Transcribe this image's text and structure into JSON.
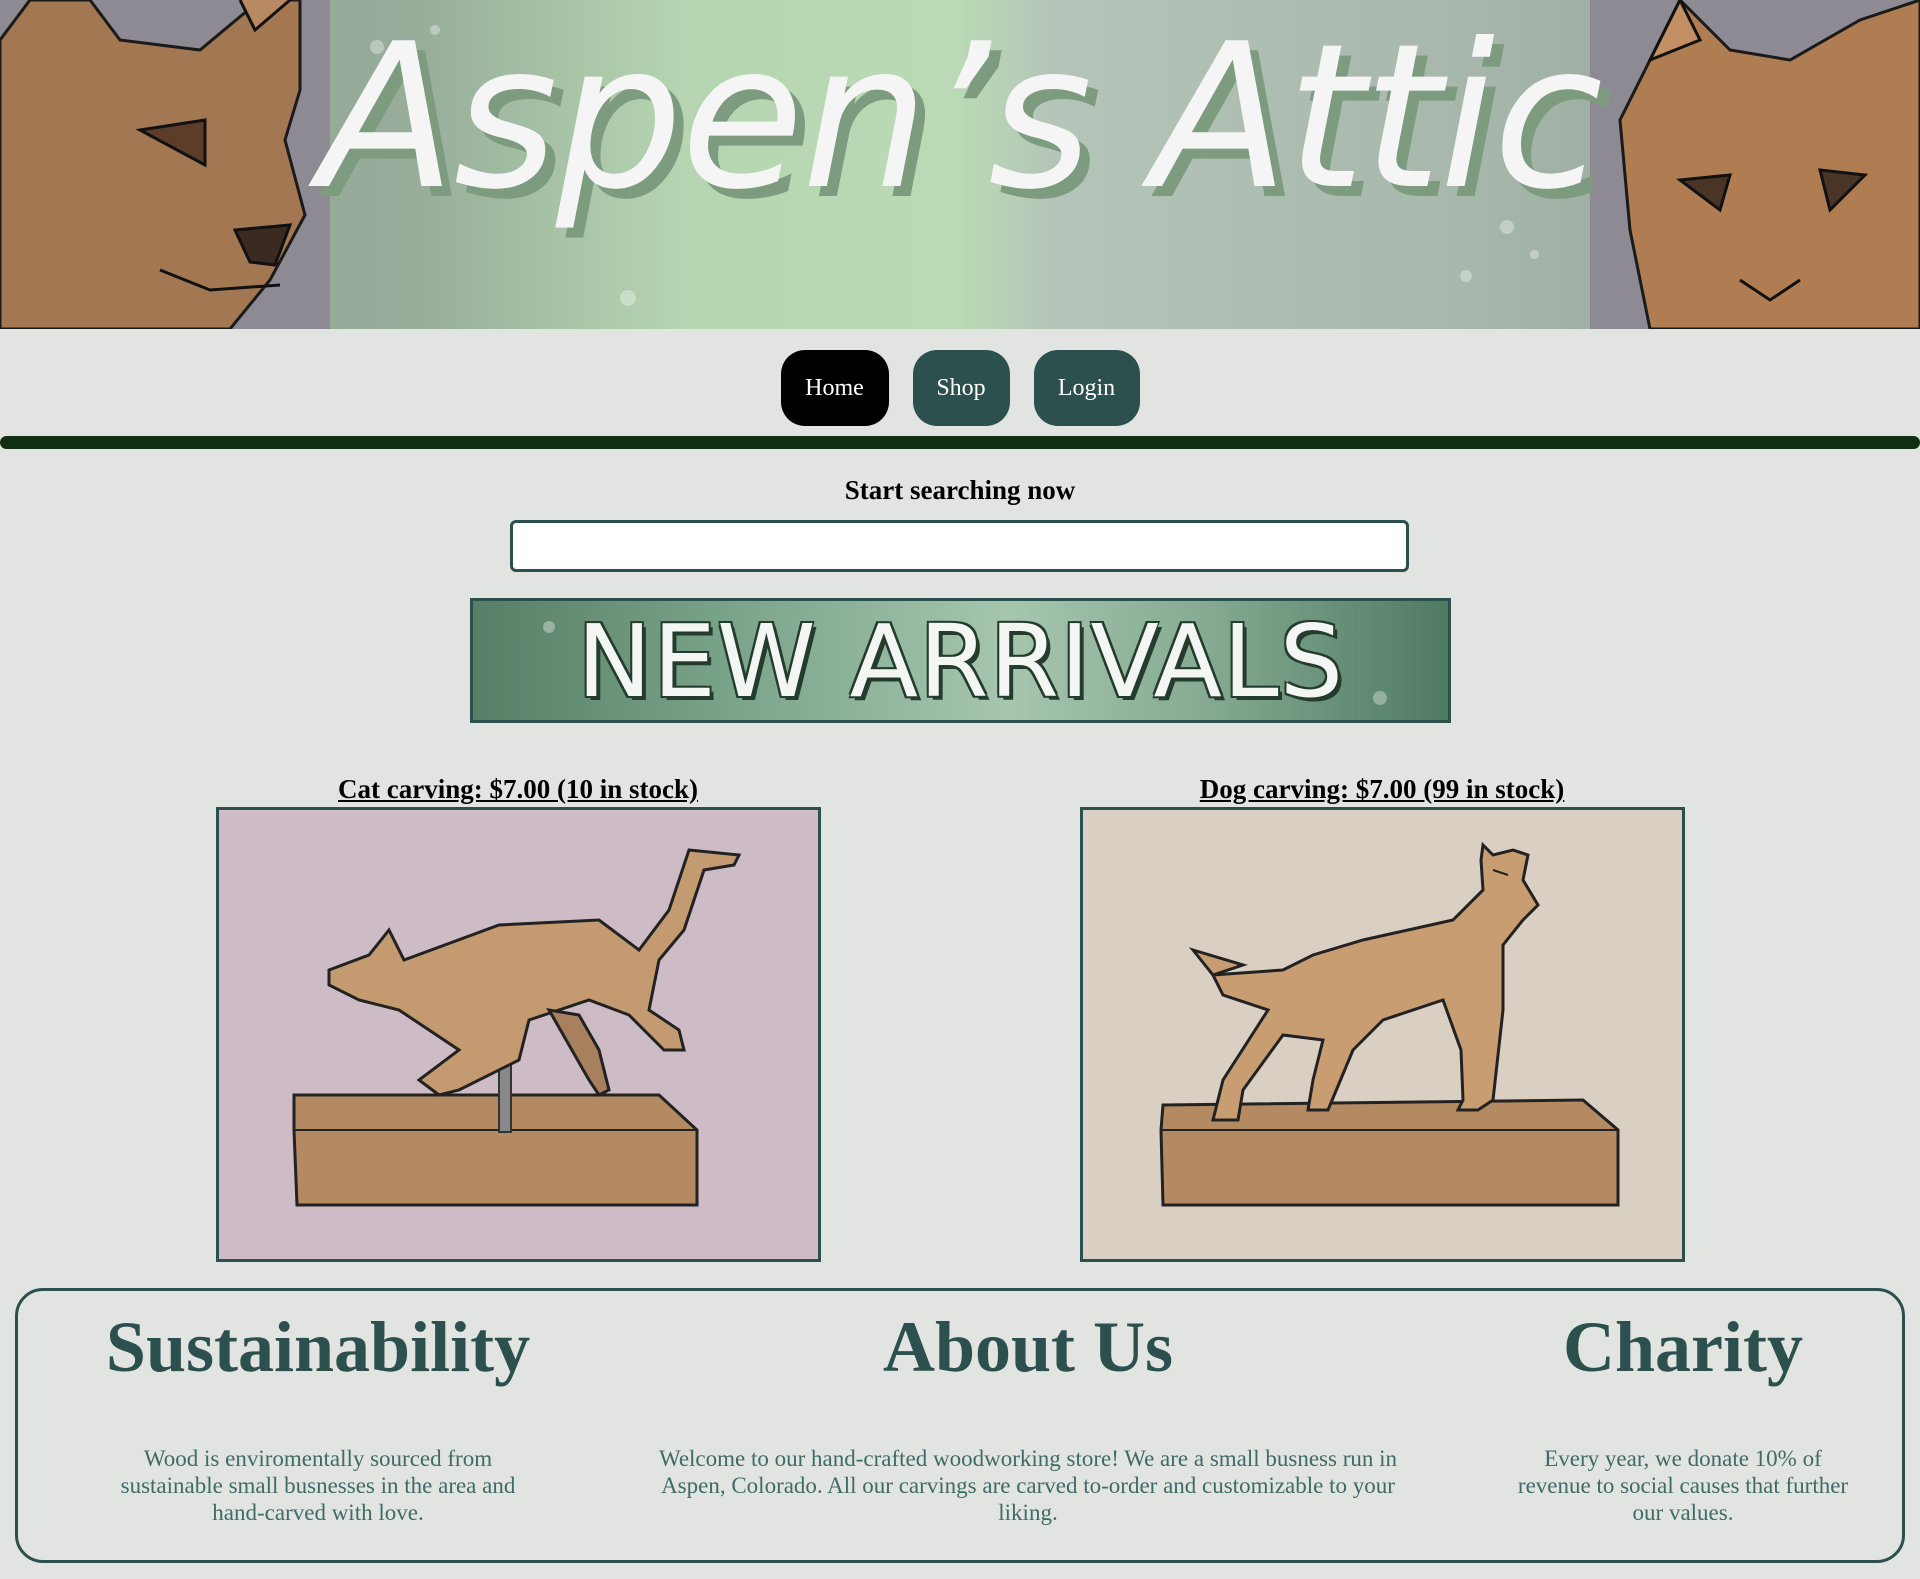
{
  "banner": {
    "title": "Aspen’s Attic"
  },
  "nav": {
    "items": [
      {
        "label": "Home",
        "active": true
      },
      {
        "label": "Shop",
        "active": false
      },
      {
        "label": "Login",
        "active": false
      }
    ]
  },
  "search": {
    "label": "Start searching now",
    "value": "",
    "placeholder": ""
  },
  "new_arrivals": {
    "label": "NEW ARRIVALS"
  },
  "products": [
    {
      "title": "Cat carving: $7.00 (10 in stock)",
      "image": "cat-carving-image"
    },
    {
      "title": "Dog carving: $7.00 (99 in stock)",
      "image": "dog-carving-image"
    }
  ],
  "info": {
    "sustainability": {
      "heading": "Sustainability",
      "text": "Wood is enviromentally sourced from sustainable small busnesses in the area and hand-carved with love."
    },
    "about": {
      "heading": "About Us",
      "text": "Welcome to our hand-crafted woodworking store! We are a small busness run in Aspen, Colorado. All our carvings are carved to-order and customizable to your liking."
    },
    "charity": {
      "heading": "Charity",
      "text": "Every year, we donate 10% of revenue to social causes that further our values."
    }
  },
  "colors": {
    "page_bg": "#e2e4e1",
    "accent": "#2c504e",
    "divider": "#0f2e12",
    "nav_active": "#000000",
    "cat_bg": "#cdbcc6",
    "dog_bg": "#d9cfc3"
  }
}
